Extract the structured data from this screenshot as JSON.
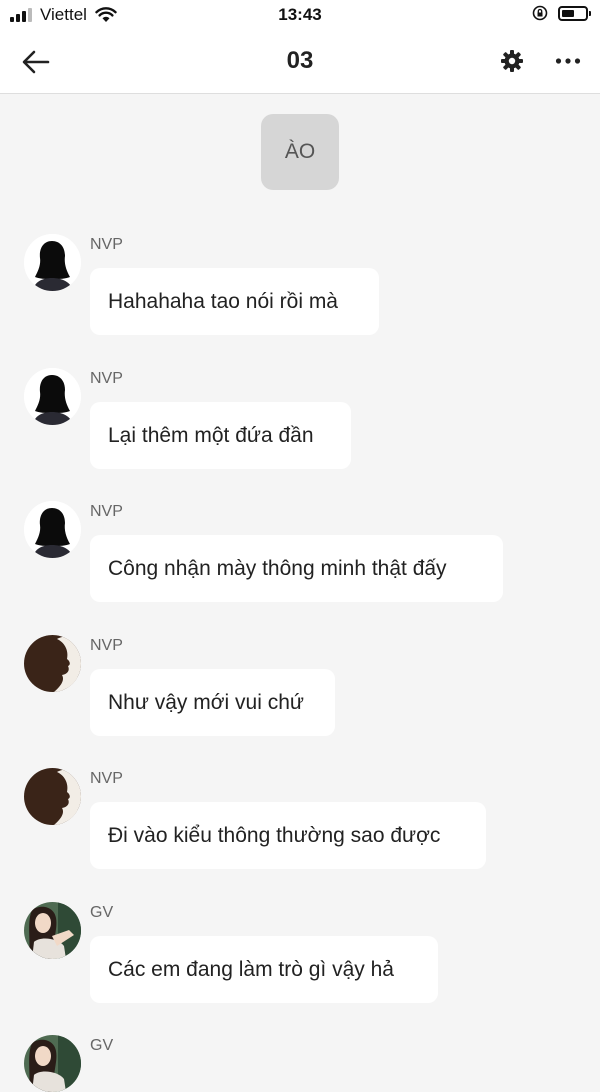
{
  "status_bar": {
    "carrier": "Viettel",
    "time": "13:43"
  },
  "header": {
    "title": "03"
  },
  "system_message": {
    "text": "ÀO"
  },
  "messages": [
    {
      "sender": "NVP",
      "text": "Hahahaha tao nói rồi mà",
      "avatar": "silhouette-girl-avatar"
    },
    {
      "sender": "NVP",
      "text": "Lại thêm một đứa đần",
      "avatar": "silhouette-girl-avatar"
    },
    {
      "sender": "NVP",
      "text": "Công nhận mày thông minh thật đấy",
      "avatar": "silhouette-girl-avatar"
    },
    {
      "sender": "NVP",
      "text": "Như vậy mới vui chứ",
      "avatar": "silhouette-man-avatar"
    },
    {
      "sender": "NVP",
      "text": "Đi vào kiểu thông thường sao được",
      "avatar": "silhouette-man-avatar"
    },
    {
      "sender": "GV",
      "text": "Các em đang làm trò gì vậy hả",
      "avatar": "photo-woman-avatar"
    },
    {
      "sender": "GV",
      "text": "",
      "avatar": "photo-woman-avatar"
    }
  ]
}
